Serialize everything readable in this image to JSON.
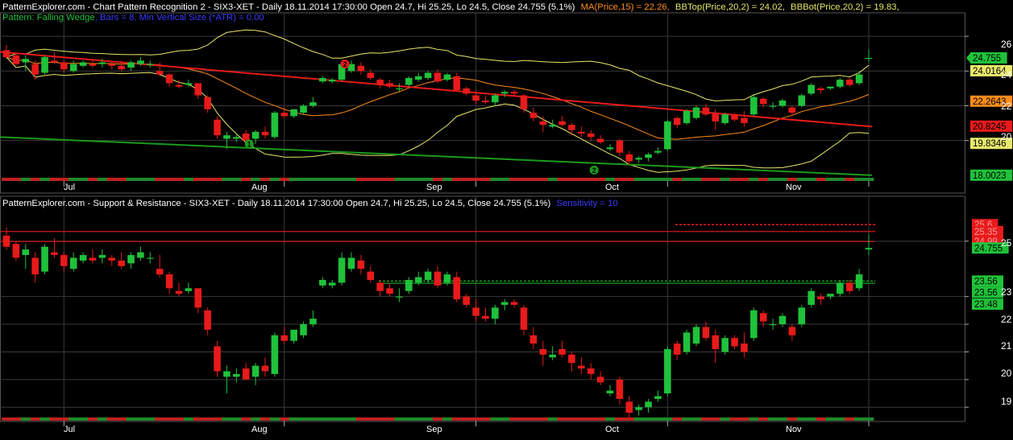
{
  "colors": {
    "background": "#000000",
    "grid": "#3a3a3a",
    "up": "#1fc23a",
    "down": "#e81a1a",
    "text": "#ffffff",
    "ma": "#ff8c1a",
    "bbtop": "#e8e86a",
    "bbbot": "#e8e86a",
    "resistance": "#e81a1a",
    "support": "#1b9a1b",
    "sensitivity": "#3a3aff"
  },
  "top_panel": {
    "header_prefix": "PatternExplorer.com - Chart Pattern Recognition 2 - SIX3-XET - Daily 18.11.2014 17:30:00 Open 24.7, Hi 25.25, Lo 24.5, Close 24.755 (5.1%)",
    "ma_label": "MA(Price,15) = 22.26,",
    "bbtop_label": "BBTop(Price,20,2) = 24.02,",
    "bbbot_label": "BBBot(Price,20,2) = 19.83,",
    "pattern_label": "Pattern: Falling Wedge",
    "pattern_params": ", Bars = 8, Min Vertical Size (*ATR) = 0.00",
    "y_ticks": [
      "26",
      "24",
      "22",
      "20"
    ],
    "markers": [
      "1",
      "2",
      "2"
    ],
    "price_tags": [
      "24.755",
      "24.0164",
      "22.2643",
      "20.8245",
      "19.8346",
      "18.0023"
    ]
  },
  "bottom_panel": {
    "header_prefix": "PatternExplorer.com - Support & Resistance - SIX3-XET - Daily 18.11.2014 17:30:00 Open 24.7, Hi 25.25, Lo 24.5, Close 24.755 (5.1%)",
    "sensitivity_label": "Sensitivity = 10",
    "y_ticks": [
      "25",
      "23",
      "22",
      "21",
      "20",
      "19"
    ],
    "price_tags": [
      "25.6",
      "25.35",
      "24.99",
      "24.755",
      "23.56",
      "23.56",
      "23.48"
    ]
  },
  "x_axis": {
    "labels": [
      "Jul",
      "Aug",
      "Sep",
      "Oct",
      "Nov"
    ]
  },
  "chart_data": [
    {
      "type": "candlestick",
      "title": "Chart Pattern Recognition 2 - SIX3-XET - Daily",
      "symbol": "SIX3-XET",
      "last_bar": {
        "date": "18.11.2014 17:30:00",
        "open": 24.7,
        "high": 25.25,
        "low": 24.5,
        "close": 24.755,
        "change_pct": 5.1
      },
      "ylim": [
        17.9,
        26.7
      ],
      "y_ticks": [
        26,
        24,
        22,
        20
      ],
      "x_labels": [
        "Jul",
        "Aug",
        "Sep",
        "Oct",
        "Nov"
      ],
      "candles": [
        [
          25.2,
          25.5,
          24.7,
          24.8
        ],
        [
          24.9,
          25.0,
          24.3,
          24.4
        ],
        [
          24.5,
          24.9,
          24.0,
          24.7
        ],
        [
          24.4,
          24.6,
          23.5,
          23.8
        ],
        [
          23.9,
          24.9,
          23.8,
          24.8
        ],
        [
          24.6,
          25.1,
          24.4,
          24.5
        ],
        [
          24.5,
          24.6,
          23.9,
          24.1
        ],
        [
          24.0,
          24.6,
          23.9,
          24.4
        ],
        [
          24.3,
          24.6,
          24.2,
          24.5
        ],
        [
          24.4,
          24.7,
          24.2,
          24.3
        ],
        [
          24.4,
          24.7,
          24.2,
          24.5
        ],
        [
          24.4,
          24.5,
          24.1,
          24.3
        ],
        [
          24.3,
          24.6,
          24.0,
          24.1
        ],
        [
          24.2,
          24.6,
          24.0,
          24.5
        ],
        [
          24.4,
          24.8,
          24.3,
          24.6
        ],
        [
          24.4,
          24.6,
          24.2,
          24.4
        ],
        [
          24.0,
          24.5,
          23.7,
          23.8
        ],
        [
          23.8,
          23.9,
          23.1,
          23.3
        ],
        [
          23.2,
          23.5,
          23.0,
          23.1
        ],
        [
          23.2,
          23.5,
          23.1,
          23.3
        ],
        [
          23.3,
          23.3,
          22.4,
          22.6
        ],
        [
          22.5,
          22.6,
          21.6,
          21.8
        ],
        [
          21.2,
          21.4,
          20.1,
          20.3
        ],
        [
          20.1,
          20.5,
          19.5,
          20.3
        ],
        [
          20.1,
          20.4,
          19.9,
          20.2
        ],
        [
          20.4,
          20.6,
          20.0,
          20.0
        ],
        [
          20.1,
          20.6,
          19.8,
          20.5
        ],
        [
          20.5,
          20.8,
          20.1,
          20.3
        ],
        [
          20.2,
          21.7,
          20.1,
          21.6
        ],
        [
          21.6,
          21.9,
          21.3,
          21.4
        ],
        [
          21.4,
          21.8,
          21.3,
          21.8
        ],
        [
          21.6,
          22.1,
          21.5,
          22.0
        ],
        [
          22.0,
          22.5,
          21.9,
          22.2
        ],
        [
          23.4,
          23.7,
          23.3,
          23.6
        ],
        [
          23.4,
          23.6,
          23.3,
          23.5
        ],
        [
          23.5,
          24.6,
          23.4,
          24.4
        ],
        [
          24.0,
          24.6,
          23.9,
          24.4
        ],
        [
          24.3,
          24.5,
          23.8,
          24.0
        ],
        [
          23.9,
          24.1,
          23.5,
          23.6
        ],
        [
          23.5,
          23.6,
          23.0,
          23.2
        ],
        [
          23.3,
          23.5,
          23.0,
          23.1
        ],
        [
          23.0,
          23.3,
          22.8,
          23.0
        ],
        [
          23.2,
          23.7,
          23.1,
          23.6
        ],
        [
          23.5,
          23.9,
          23.4,
          23.7
        ],
        [
          23.6,
          24.0,
          23.5,
          23.9
        ],
        [
          23.9,
          24.1,
          23.3,
          23.4
        ],
        [
          23.5,
          23.9,
          23.4,
          23.8
        ],
        [
          23.7,
          23.9,
          22.8,
          22.9
        ],
        [
          23.0,
          23.1,
          22.6,
          22.7
        ],
        [
          22.6,
          22.9,
          22.1,
          22.3
        ],
        [
          22.3,
          22.6,
          22.1,
          22.2
        ],
        [
          22.2,
          22.7,
          22.0,
          22.6
        ],
        [
          22.7,
          22.9,
          22.5,
          22.8
        ],
        [
          22.8,
          22.9,
          22.6,
          22.7
        ],
        [
          22.6,
          22.7,
          21.6,
          21.8
        ],
        [
          21.6,
          21.9,
          21.1,
          21.3
        ],
        [
          21.1,
          21.4,
          20.5,
          20.9
        ],
        [
          20.8,
          21.2,
          20.7,
          20.9
        ],
        [
          21.1,
          21.4,
          20.8,
          20.9
        ],
        [
          20.9,
          21.0,
          20.3,
          20.6
        ],
        [
          20.5,
          20.8,
          20.2,
          20.4
        ],
        [
          20.4,
          20.6,
          20.0,
          20.2
        ],
        [
          20.1,
          20.3,
          19.8,
          19.9
        ],
        [
          19.5,
          19.8,
          19.4,
          19.6
        ],
        [
          20.0,
          20.1,
          19.1,
          19.3
        ],
        [
          19.2,
          19.4,
          18.6,
          18.8
        ],
        [
          18.9,
          19.1,
          18.7,
          19.0
        ],
        [
          19.0,
          19.3,
          18.8,
          19.2
        ],
        [
          19.3,
          19.6,
          19.2,
          19.4
        ],
        [
          19.5,
          21.2,
          19.4,
          21.1
        ],
        [
          21.3,
          21.4,
          20.7,
          20.9
        ],
        [
          21.0,
          21.8,
          20.9,
          21.7
        ],
        [
          21.3,
          22.0,
          21.2,
          21.9
        ],
        [
          21.9,
          22.1,
          21.4,
          21.5
        ],
        [
          21.6,
          21.8,
          20.6,
          21.1
        ],
        [
          21.0,
          21.6,
          20.9,
          21.5
        ],
        [
          21.5,
          21.6,
          21.1,
          21.2
        ],
        [
          21.3,
          21.7,
          20.8,
          21.0
        ],
        [
          21.5,
          22.6,
          21.4,
          22.5
        ],
        [
          22.4,
          22.5,
          21.9,
          22.1
        ],
        [
          22.0,
          22.2,
          21.8,
          22.0
        ],
        [
          22.0,
          22.4,
          21.9,
          22.3
        ],
        [
          21.9,
          22.0,
          21.4,
          21.6
        ],
        [
          22.0,
          22.7,
          21.9,
          22.6
        ],
        [
          22.7,
          23.3,
          22.6,
          23.2
        ],
        [
          23.0,
          23.1,
          22.7,
          22.9
        ],
        [
          23.0,
          23.1,
          22.9,
          23.1
        ],
        [
          23.1,
          23.6,
          23.0,
          23.5
        ],
        [
          23.5,
          23.6,
          23.1,
          23.2
        ],
        [
          23.3,
          24.0,
          23.2,
          23.8
        ],
        [
          24.7,
          25.25,
          24.5,
          24.755
        ]
      ],
      "series": [
        {
          "name": "MA(Price,15)",
          "last_value": 22.26
        },
        {
          "name": "BBTop(Price,20,2)",
          "last_value": 24.02
        },
        {
          "name": "BBBot(Price,20,2)",
          "last_value": 19.83
        }
      ],
      "pattern": {
        "name": "Falling Wedge",
        "bars": 8,
        "min_vertical_size_atr": 0.0
      }
    },
    {
      "type": "candlestick",
      "title": "Support & Resistance - SIX3-XET - Daily",
      "symbol": "SIX3-XET",
      "sensitivity": 10,
      "ylim": [
        18.6,
        26.1
      ],
      "y_ticks": [
        25,
        23,
        22,
        21,
        20,
        19
      ],
      "x_labels": [
        "Jul",
        "Aug",
        "Sep",
        "Oct",
        "Nov"
      ],
      "resistance_levels": [
        25.6,
        25.35,
        24.99
      ],
      "support_levels": [
        23.56,
        23.56,
        23.48
      ],
      "last_close": 24.755
    }
  ]
}
